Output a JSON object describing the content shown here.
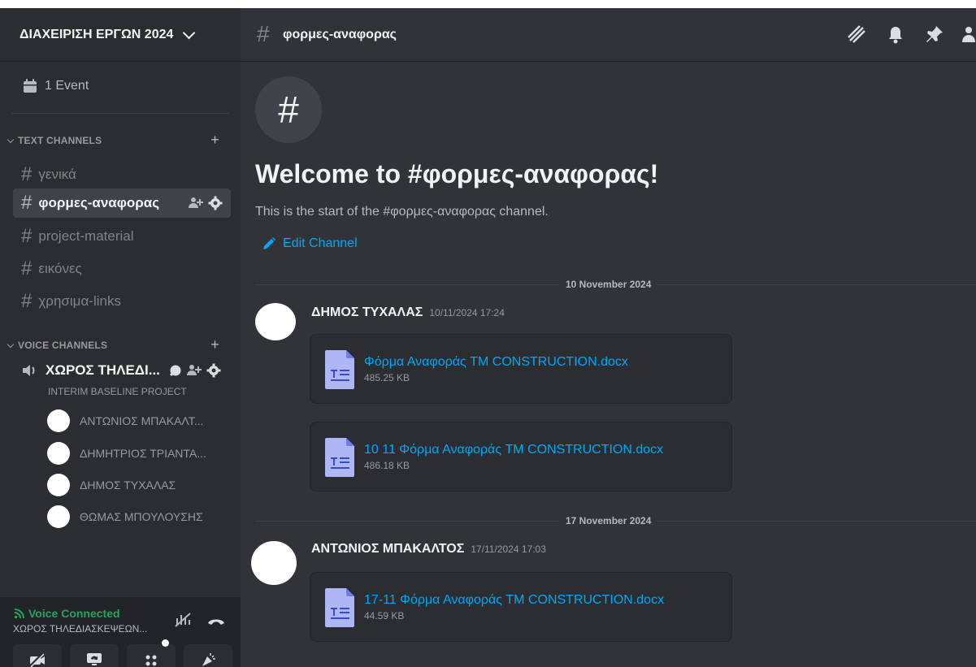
{
  "server": {
    "name": "ΔΙΑΧΕΙΡΙΣΗ ΕΡΓΩΝ 2024"
  },
  "events": {
    "label": "1 Event"
  },
  "text_category": {
    "label": "TEXT CHANNELS",
    "add": "+"
  },
  "text_channels": [
    {
      "name": "γενικά"
    },
    {
      "name": "φορμες-αναφορας"
    },
    {
      "name": "project-material"
    },
    {
      "name": "εικόνες"
    },
    {
      "name": "χρησιμα-links"
    }
  ],
  "voice_category": {
    "label": "VOICE CHANNELS",
    "add": "+"
  },
  "voice_channel": {
    "name": "ΧΩΡΟΣ ΤΗΛΕΔΙ...",
    "subtitle": "INTERIM BASELINE PROJECT",
    "users": [
      {
        "name": "ΑΝΤΩΝΙΟΣ ΜΠΑΚΑΛΤ..."
      },
      {
        "name": "ΔΗΜΗΤΡΙΟΣ ΤΡΙΑΝΤΑ..."
      },
      {
        "name": "ΔΗΜΟΣ ΤΥΧΑΛΑΣ"
      },
      {
        "name": "ΘΩΜΑΣ ΜΠΟΥΛΟΥΣΗΣ"
      }
    ]
  },
  "voice_panel": {
    "status": "Voice Connected",
    "channel": "ΧΩΡΟΣ ΤΗΛΕΔΙΑΣΚΕΨΕΩΝ..."
  },
  "topbar": {
    "hash": "#",
    "channel": "φορμες-αναφορας"
  },
  "welcome": {
    "icon": "#",
    "title": "Welcome to #φορμες-αναφορας!",
    "subtitle": "This is the start of the #φορμες-αναφορας channel.",
    "edit_label": "Edit Channel"
  },
  "dividers": [
    {
      "label": "10 November 2024"
    },
    {
      "label": "17 November 2024"
    }
  ],
  "messages": [
    {
      "author": "ΔΗΜΟΣ ΤΥΧΑΛΑΣ",
      "time": "10/11/2024 17:24",
      "attachments": [
        {
          "name": "Φόρμα Αναφοράς TM CONSTRUCTION.docx",
          "size": "485.25 KB"
        },
        {
          "name": "10 11 Φόρμα Αναφοράς TM CONSTRUCTION.docx",
          "size": "486.18 KB"
        }
      ]
    },
    {
      "author": "ΑΝΤΩΝΙΟΣ ΜΠΑΚΑΛΤΟΣ",
      "time": "17/11/2024 17:03",
      "attachments": [
        {
          "name": "17-11 Φόρμα Αναφοράς TM CONSTRUCTION.docx",
          "size": "44.59 KB"
        }
      ]
    }
  ],
  "colors": {
    "accent": "#00a8fc",
    "voice_green": "#23a55a",
    "background": "#313338",
    "sidebar": "#2b2d31"
  }
}
